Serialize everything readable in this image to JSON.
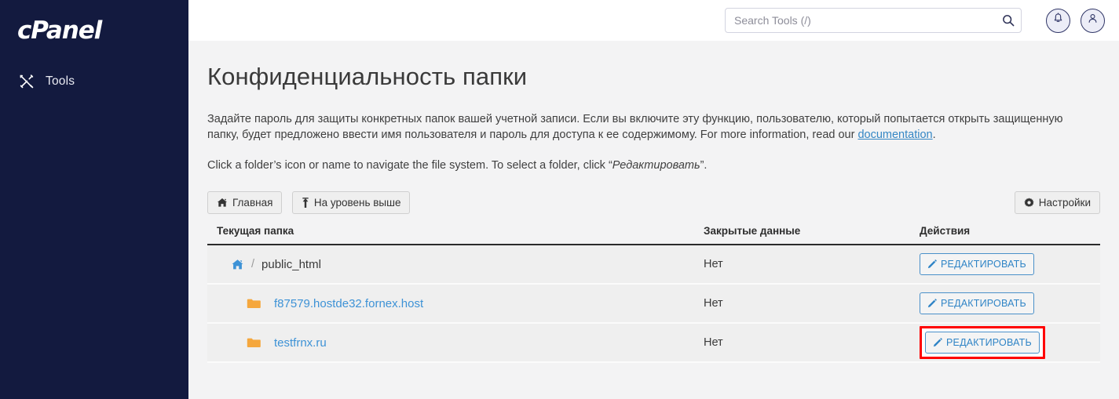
{
  "sidebar": {
    "brand": "cPanel",
    "items": [
      {
        "label": "Tools",
        "icon": "tools-icon"
      }
    ]
  },
  "topbar": {
    "search": {
      "placeholder": "Search Tools (/)",
      "value": "",
      "icon": "search-icon"
    },
    "notifications_icon": "bell-icon",
    "account_icon": "user-icon"
  },
  "main": {
    "title": "Конфиденциальность папки",
    "description_1_part1": "Задайте пароль для защиты конкретных папок вашей учетной записи. Если вы включите эту функцию, пользователю, который попытается открыть защищенную папку, будет предложено ввести имя пользователя и пароль для доступа к ее содержимому. For more information, read our ",
    "description_1_link": "documentation",
    "description_1_part2": ".",
    "description_2_part1": "Click a folder’s icon or name to navigate the file system. To select a folder, click “",
    "description_2_emphasis": "Редактировать",
    "description_2_part2": "”.",
    "buttons": {
      "home": {
        "label": "Главная",
        "icon": "home-icon"
      },
      "up_one_level": {
        "label": "На уровень выше",
        "icon": "arrow-up-icon"
      },
      "settings": {
        "label": "Настройки",
        "icon": "gear-icon"
      }
    },
    "table": {
      "headers": {
        "folder": "Текущая папка",
        "private": "Закрытые данные",
        "actions": "Действия"
      },
      "rows": [
        {
          "icon": "home-icon",
          "separator": "/",
          "name": "public_html",
          "is_link": false,
          "private": "Нет",
          "action_label": "РЕДАКТИРОВАТЬ",
          "action_icon": "pencil-icon",
          "highlighted": false
        },
        {
          "icon": "folder-icon",
          "separator": "",
          "name": "f87579.hostde32.fornex.host",
          "is_link": true,
          "private": "Нет",
          "action_label": "РЕДАКТИРОВАТЬ",
          "action_icon": "pencil-icon",
          "highlighted": false
        },
        {
          "icon": "folder-icon",
          "separator": "",
          "name": "testfrnx.ru",
          "is_link": true,
          "private": "Нет",
          "action_label": "РЕДАКТИРОВАТЬ",
          "action_icon": "pencil-icon",
          "highlighted": true
        }
      ]
    }
  },
  "colors": {
    "sidebar_bg": "#131a3f",
    "content_bg": "#f3f3f4",
    "link_blue": "#3d92d6",
    "folder_orange": "#f5a73d",
    "highlight_red": "#ff0000",
    "row_bg": "#efefef"
  }
}
